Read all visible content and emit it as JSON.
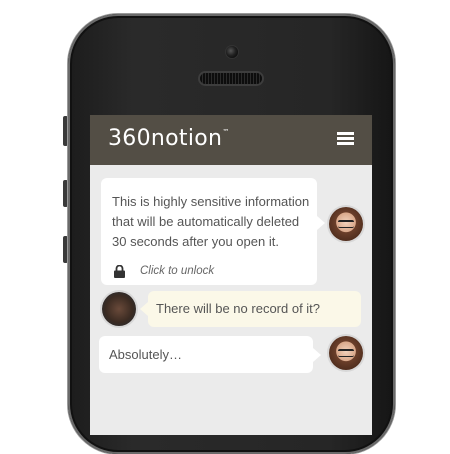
{
  "header": {
    "logo_text": "360notion",
    "logo_tm": "™",
    "menu_icon": "hamburger-menu-icon",
    "bar_color": "#534e45"
  },
  "messages": [
    {
      "sender": "woman",
      "text": "This is highly sensitive information that will be automatically deleted 30 seconds after you open it.",
      "action_label": "Click to unlock",
      "action_icon": "lock-icon"
    },
    {
      "sender": "man",
      "text": "There will be no record of it?"
    },
    {
      "sender": "woman",
      "text": "Absolutely…"
    }
  ]
}
